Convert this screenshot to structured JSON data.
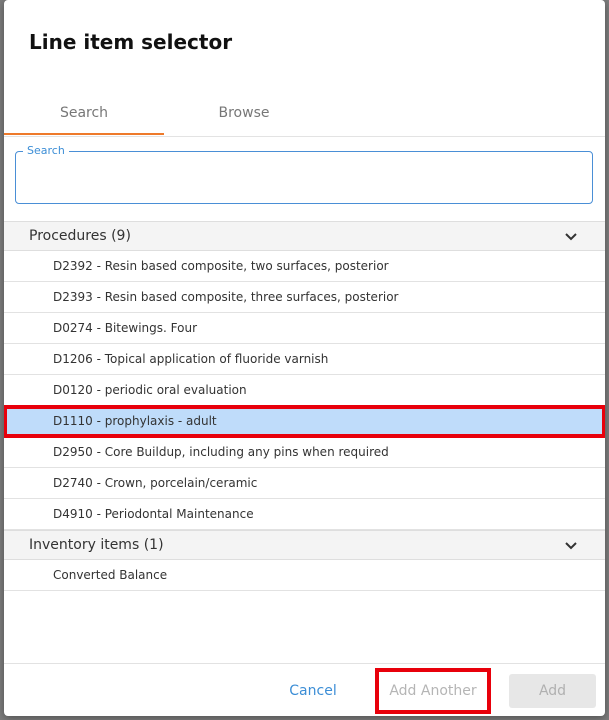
{
  "dialog": {
    "title": "Line item selector"
  },
  "tabs": [
    {
      "label": "Search",
      "active": true
    },
    {
      "label": "Browse",
      "active": false
    }
  ],
  "search": {
    "label": "Search",
    "value": "",
    "placeholder": ""
  },
  "groups": [
    {
      "title": "Procedures (9)",
      "icon": "chevron-down-icon",
      "items": [
        {
          "label": "D2392 - Resin based composite, two surfaces, posterior"
        },
        {
          "label": "D2393 - Resin based composite, three surfaces, posterior"
        },
        {
          "label": "D0274 - Bitewings. Four"
        },
        {
          "label": "D1206 - Topical application of fluoride varnish"
        },
        {
          "label": "D0120 - periodic oral evaluation"
        },
        {
          "label": "D1110 - prophylaxis - adult",
          "selected": true
        },
        {
          "label": "D2950 - Core Buildup, including any pins when required"
        },
        {
          "label": "D2740 - Crown, porcelain/ceramic"
        },
        {
          "label": "D4910 - Periodontal Maintenance"
        }
      ]
    },
    {
      "title": "Inventory items (1)",
      "icon": "chevron-down-icon",
      "items": [
        {
          "label": "Converted Balance"
        }
      ]
    }
  ],
  "footer": {
    "cancel_label": "Cancel",
    "add_another_label": "Add Another",
    "add_label": "Add"
  },
  "colors": {
    "accent": "#3c8ed6",
    "tab_indicator": "#ee7a2b",
    "selected_row": "#bfdcfa",
    "highlight": "#e8000b"
  }
}
